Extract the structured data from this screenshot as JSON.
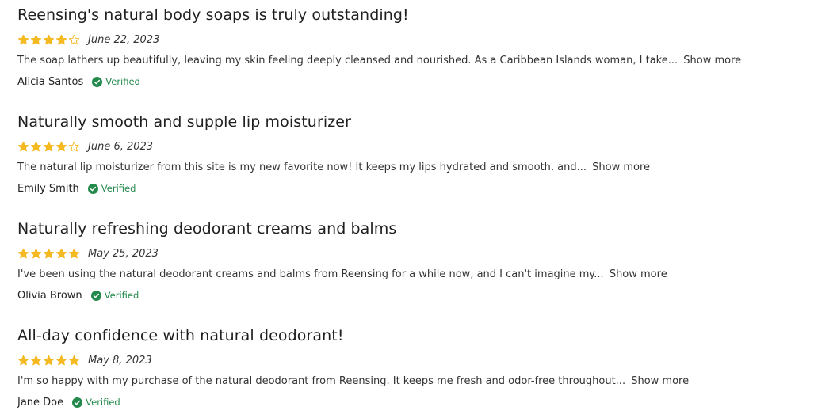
{
  "accent_color": "#f5b921",
  "verified_color": "#238a4c",
  "reviews": [
    {
      "title": "Reensing's natural body soaps is truly outstanding!",
      "rating": 4,
      "rating_max": 5,
      "date": "June 22, 2023",
      "body": "The soap lathers up beautifully, leaving my skin feeling deeply cleansed and nourished. As a Caribbean Islands woman, I take...",
      "show_more": "Show more",
      "author": "Alicia Santos",
      "verified_label": "Verified",
      "verified_icon": "check-circle-icon"
    },
    {
      "title": "Naturally smooth and supple lip moisturizer",
      "rating": 4,
      "rating_max": 5,
      "date": "June 6, 2023",
      "body": "The natural lip moisturizer from this site is my new favorite now! It keeps my lips hydrated and smooth, and...",
      "show_more": "Show more",
      "author": "Emily Smith",
      "verified_label": "Verified",
      "verified_icon": "check-circle-icon"
    },
    {
      "title": "Naturally refreshing deodorant creams and balms",
      "rating": 5,
      "rating_max": 5,
      "date": "May 25, 2023",
      "body": "I've been using the natural deodorant creams and balms from Reensing for a while now, and I can't imagine my...",
      "show_more": "Show more",
      "author": "Olivia Brown",
      "verified_label": "Verified",
      "verified_icon": "check-circle-icon"
    },
    {
      "title": "All-day confidence with natural deodorant!",
      "rating": 5,
      "rating_max": 5,
      "date": "May 8, 2023",
      "body": "I'm so happy with my purchase of the natural deodorant from Reensing. It keeps me fresh and odor-free throughout...",
      "show_more": "Show more",
      "author": "Jane Doe",
      "verified_label": "Verified",
      "verified_icon": "check-circle-icon"
    }
  ]
}
